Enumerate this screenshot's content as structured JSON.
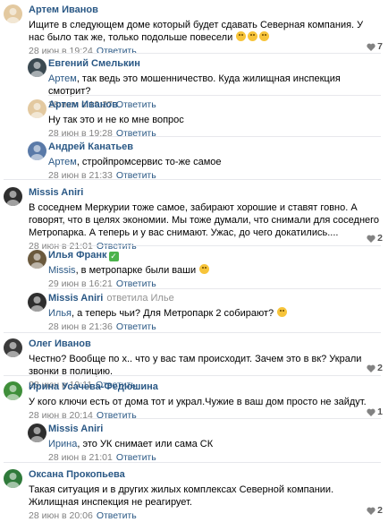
{
  "comments": [
    {
      "author": "Артем Иванов",
      "text": "Ищите в следующем доме который будет сдавать Северная компания. У нас было так же, только подольше повесели",
      "date": "28 июн в 19:24",
      "reply_label": "Ответить",
      "likes": "7",
      "avatar_color": "#e3c9a0"
    },
    {
      "author": "Евгений Смелькин",
      "addressee": "Артем",
      "text": ", так ведь это мошенничество. Куда жилищная инспекция смотрит?",
      "date": "28 июн в 19:27",
      "reply_label": "Ответить",
      "avatar_color": "#3b4a52"
    },
    {
      "author": "Артем Иванов",
      "text": "Ну так это и не ко мне вопрос",
      "date": "28 июн в 19:28",
      "reply_label": "Ответить",
      "avatar_color": "#e3c9a0"
    },
    {
      "author": "Андрей Канатьев",
      "addressee": "Артем",
      "text": ", стройпромсервис то-же самое",
      "date": "28 июн в 21:33",
      "reply_label": "Ответить",
      "avatar_color": "#5a7aa8"
    },
    {
      "author": "Missis Aniri",
      "text": "В соседнем Меркурии тоже самое, забирают хорошие и ставят говно. А говорят, что в целях экономии. Мы тоже думали, что снимали для соседнего Метропарка. А теперь и у вас снимают. Ужас, до чего докатились....",
      "date": "28 июн в 21:01",
      "reply_label": "Ответить",
      "likes": "2",
      "avatar_color": "#2e2e2e"
    },
    {
      "author": "Илья Франк",
      "addressee": "Missis",
      "text": ", в метропарке были ваши",
      "date": "29 июн в 16:21",
      "reply_label": "Ответить",
      "avatar_color": "#6b5a3e"
    },
    {
      "author": "Missis Aniri",
      "reply_to_label": "ответила",
      "reply_to_name": "Илье",
      "addressee": "Илья",
      "text": ", а теперь чьи? Для Метропарк 2 собирают?",
      "date": "28 июн в 21:36",
      "reply_label": "Ответить",
      "avatar_color": "#2e2e2e"
    },
    {
      "author": "Олег Иванов",
      "text": "Честно? Вообще по х.. что у вас там происходит. Зачем это в вк? Украли звонки в полицию.",
      "date": "28 июн в 19:11",
      "reply_label": "Ответить",
      "likes": "2",
      "avatar_color": "#3a3a3a"
    },
    {
      "author": "Ирина Усачева-Федюшина",
      "text": "У кого ключи есть от дома тот и украл.Чужие в ваш дом просто не зайдут.",
      "date": "28 июн в 20:14",
      "reply_label": "Ответить",
      "likes": "1",
      "avatar_color": "#3f8f3a"
    },
    {
      "author": "Missis Aniri",
      "addressee": "Ирина",
      "text": ", это УК снимает или сама СК",
      "date": "28 июн в 21:01",
      "reply_label": "Ответить",
      "avatar_color": "#2e2e2e"
    },
    {
      "author": "Оксана Прокопьева",
      "text": "Такая ситуация и в других жилых комплексах Северной компании. Жилищная инспекция не реагирует.",
      "date": "28 июн в 20:06",
      "reply_label": "Ответить",
      "likes": "2",
      "avatar_color": "#2f7a3a"
    }
  ]
}
